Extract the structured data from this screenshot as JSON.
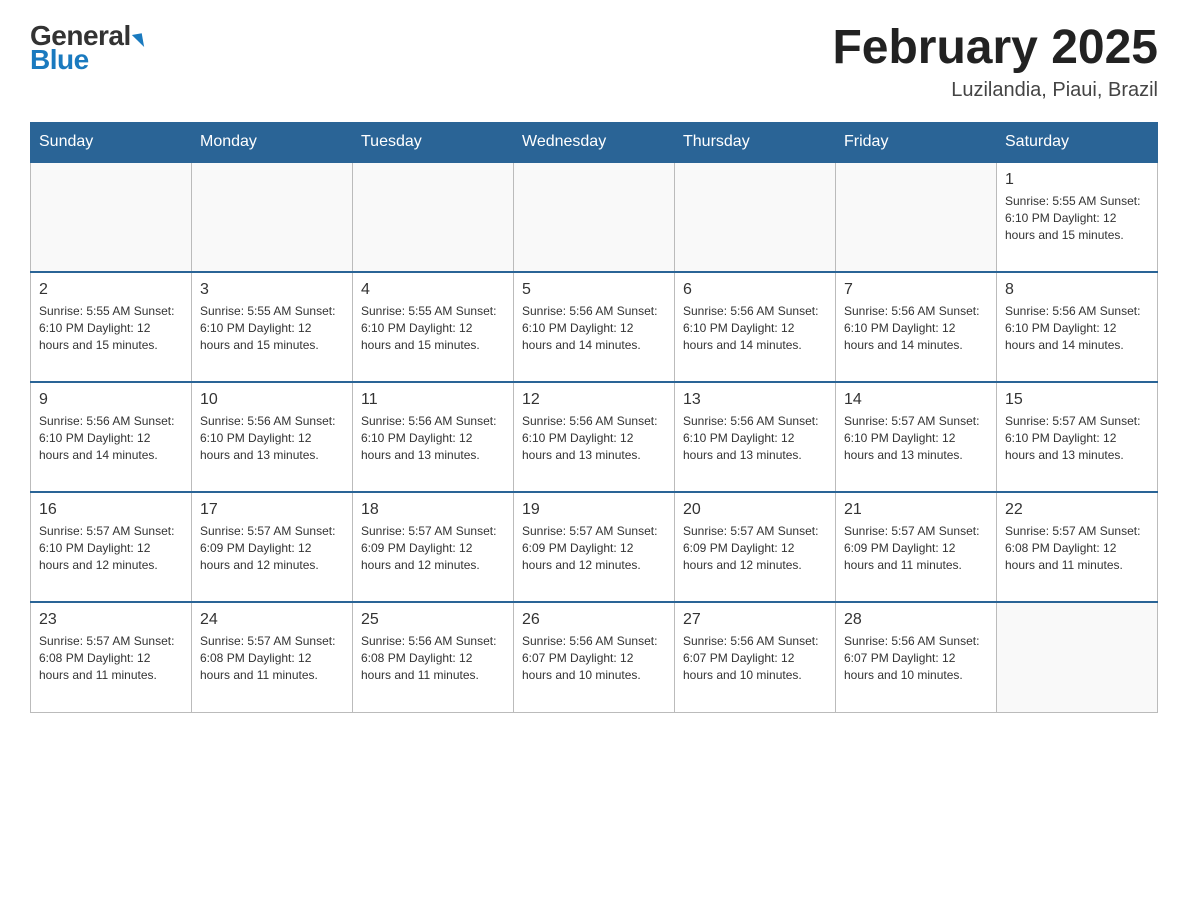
{
  "logo": {
    "general": "General",
    "blue": "Blue"
  },
  "title": "February 2025",
  "location": "Luzilandia, Piaui, Brazil",
  "days_of_week": [
    "Sunday",
    "Monday",
    "Tuesday",
    "Wednesday",
    "Thursday",
    "Friday",
    "Saturday"
  ],
  "weeks": [
    [
      {
        "day": "",
        "info": ""
      },
      {
        "day": "",
        "info": ""
      },
      {
        "day": "",
        "info": ""
      },
      {
        "day": "",
        "info": ""
      },
      {
        "day": "",
        "info": ""
      },
      {
        "day": "",
        "info": ""
      },
      {
        "day": "1",
        "info": "Sunrise: 5:55 AM\nSunset: 6:10 PM\nDaylight: 12 hours and 15 minutes."
      }
    ],
    [
      {
        "day": "2",
        "info": "Sunrise: 5:55 AM\nSunset: 6:10 PM\nDaylight: 12 hours and 15 minutes."
      },
      {
        "day": "3",
        "info": "Sunrise: 5:55 AM\nSunset: 6:10 PM\nDaylight: 12 hours and 15 minutes."
      },
      {
        "day": "4",
        "info": "Sunrise: 5:55 AM\nSunset: 6:10 PM\nDaylight: 12 hours and 15 minutes."
      },
      {
        "day": "5",
        "info": "Sunrise: 5:56 AM\nSunset: 6:10 PM\nDaylight: 12 hours and 14 minutes."
      },
      {
        "day": "6",
        "info": "Sunrise: 5:56 AM\nSunset: 6:10 PM\nDaylight: 12 hours and 14 minutes."
      },
      {
        "day": "7",
        "info": "Sunrise: 5:56 AM\nSunset: 6:10 PM\nDaylight: 12 hours and 14 minutes."
      },
      {
        "day": "8",
        "info": "Sunrise: 5:56 AM\nSunset: 6:10 PM\nDaylight: 12 hours and 14 minutes."
      }
    ],
    [
      {
        "day": "9",
        "info": "Sunrise: 5:56 AM\nSunset: 6:10 PM\nDaylight: 12 hours and 14 minutes."
      },
      {
        "day": "10",
        "info": "Sunrise: 5:56 AM\nSunset: 6:10 PM\nDaylight: 12 hours and 13 minutes."
      },
      {
        "day": "11",
        "info": "Sunrise: 5:56 AM\nSunset: 6:10 PM\nDaylight: 12 hours and 13 minutes."
      },
      {
        "day": "12",
        "info": "Sunrise: 5:56 AM\nSunset: 6:10 PM\nDaylight: 12 hours and 13 minutes."
      },
      {
        "day": "13",
        "info": "Sunrise: 5:56 AM\nSunset: 6:10 PM\nDaylight: 12 hours and 13 minutes."
      },
      {
        "day": "14",
        "info": "Sunrise: 5:57 AM\nSunset: 6:10 PM\nDaylight: 12 hours and 13 minutes."
      },
      {
        "day": "15",
        "info": "Sunrise: 5:57 AM\nSunset: 6:10 PM\nDaylight: 12 hours and 13 minutes."
      }
    ],
    [
      {
        "day": "16",
        "info": "Sunrise: 5:57 AM\nSunset: 6:10 PM\nDaylight: 12 hours and 12 minutes."
      },
      {
        "day": "17",
        "info": "Sunrise: 5:57 AM\nSunset: 6:09 PM\nDaylight: 12 hours and 12 minutes."
      },
      {
        "day": "18",
        "info": "Sunrise: 5:57 AM\nSunset: 6:09 PM\nDaylight: 12 hours and 12 minutes."
      },
      {
        "day": "19",
        "info": "Sunrise: 5:57 AM\nSunset: 6:09 PM\nDaylight: 12 hours and 12 minutes."
      },
      {
        "day": "20",
        "info": "Sunrise: 5:57 AM\nSunset: 6:09 PM\nDaylight: 12 hours and 12 minutes."
      },
      {
        "day": "21",
        "info": "Sunrise: 5:57 AM\nSunset: 6:09 PM\nDaylight: 12 hours and 11 minutes."
      },
      {
        "day": "22",
        "info": "Sunrise: 5:57 AM\nSunset: 6:08 PM\nDaylight: 12 hours and 11 minutes."
      }
    ],
    [
      {
        "day": "23",
        "info": "Sunrise: 5:57 AM\nSunset: 6:08 PM\nDaylight: 12 hours and 11 minutes."
      },
      {
        "day": "24",
        "info": "Sunrise: 5:57 AM\nSunset: 6:08 PM\nDaylight: 12 hours and 11 minutes."
      },
      {
        "day": "25",
        "info": "Sunrise: 5:56 AM\nSunset: 6:08 PM\nDaylight: 12 hours and 11 minutes."
      },
      {
        "day": "26",
        "info": "Sunrise: 5:56 AM\nSunset: 6:07 PM\nDaylight: 12 hours and 10 minutes."
      },
      {
        "day": "27",
        "info": "Sunrise: 5:56 AM\nSunset: 6:07 PM\nDaylight: 12 hours and 10 minutes."
      },
      {
        "day": "28",
        "info": "Sunrise: 5:56 AM\nSunset: 6:07 PM\nDaylight: 12 hours and 10 minutes."
      },
      {
        "day": "",
        "info": ""
      }
    ]
  ]
}
